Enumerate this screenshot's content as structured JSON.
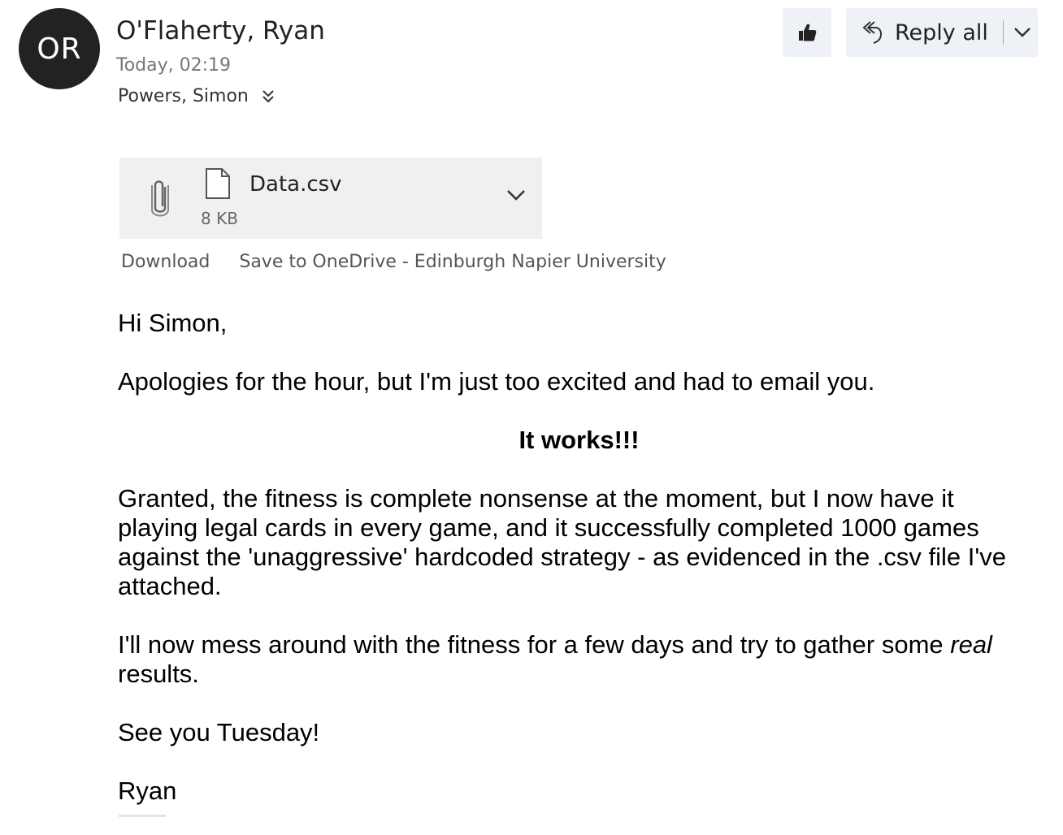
{
  "sender": {
    "initials": "OR",
    "name": "O'Flaherty, Ryan",
    "time": "Today, 02:19",
    "recipient": "Powers, Simon",
    "avatar_color": "#222222"
  },
  "toolbar": {
    "like_icon": "thumbs-up-icon",
    "reply_all_label": "Reply all",
    "reply_icon": "reply-all-icon",
    "dropdown_icon": "chevron-down-icon"
  },
  "attachment": {
    "file_name": "Data.csv",
    "file_size": "8 KB",
    "download_label": "Download",
    "save_label": "Save to OneDrive - Edinburgh Napier University"
  },
  "message": {
    "greeting": "Hi Simon,",
    "para1": "Apologies for the hour, but I'm just too excited and had to email you.",
    "headline": "It works!!!",
    "para2": "Granted, the fitness is complete nonsense at the moment, but I now have it playing legal cards in every game, and it successfully completed 1000 games against the 'unaggressive' hardcoded strategy - as evidenced in the .csv file I've attached.",
    "para3_before": "I'll now mess around with the fitness for a few days and try to gather some ",
    "para3_emphasis": "real",
    "para3_after": " results.",
    "para4": "See you Tuesday!",
    "signature": "Ryan"
  }
}
